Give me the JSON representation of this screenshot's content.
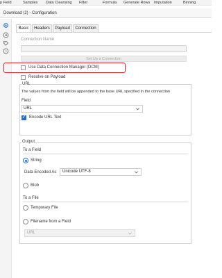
{
  "ribbon": {
    "items": [
      "p Field",
      "Samples",
      "Data Cleansing",
      "Filter",
      "Formula",
      "Generate Rows",
      "Imputation",
      "Binning"
    ]
  },
  "titlebar": {
    "title": "Download (2) - Configuration"
  },
  "tabs": [
    {
      "label": "Basic",
      "active": true
    },
    {
      "label": "Headers",
      "active": false
    },
    {
      "label": "Payload",
      "active": false
    },
    {
      "label": "Connection",
      "active": false
    }
  ],
  "connection": {
    "name_label": "Connection Name",
    "name_value": "",
    "setup_button": "Set Up a Connection"
  },
  "dcm": {
    "label": "Use Data Connection Manager (DCM)",
    "checked": false
  },
  "resolve": {
    "label": "Resolve on Payload",
    "checked": false
  },
  "url": {
    "section_label": "URL",
    "description": "The values from the field will be appended to the base URL specified in the connection",
    "field_label": "Field",
    "field_value": "URL",
    "encode_label": "Encode URL Text",
    "encode_checked": true
  },
  "output": {
    "title": "Output",
    "to_field": {
      "title": "To a Field",
      "string_label": "String",
      "string_selected": true,
      "encoded_label": "Data Encoded As",
      "encoded_value": "Unicode UTF-8",
      "blob_label": "Blob",
      "blob_selected": false
    },
    "to_file": {
      "title": "To a File",
      "temp_label": "Temporary File",
      "temp_selected": false,
      "filename_label": "Filename from a Field",
      "filename_selected": false,
      "filename_field_value": "URL"
    }
  },
  "colors": {
    "accent": "#1f6fd1",
    "highlight": "#e0212b"
  }
}
